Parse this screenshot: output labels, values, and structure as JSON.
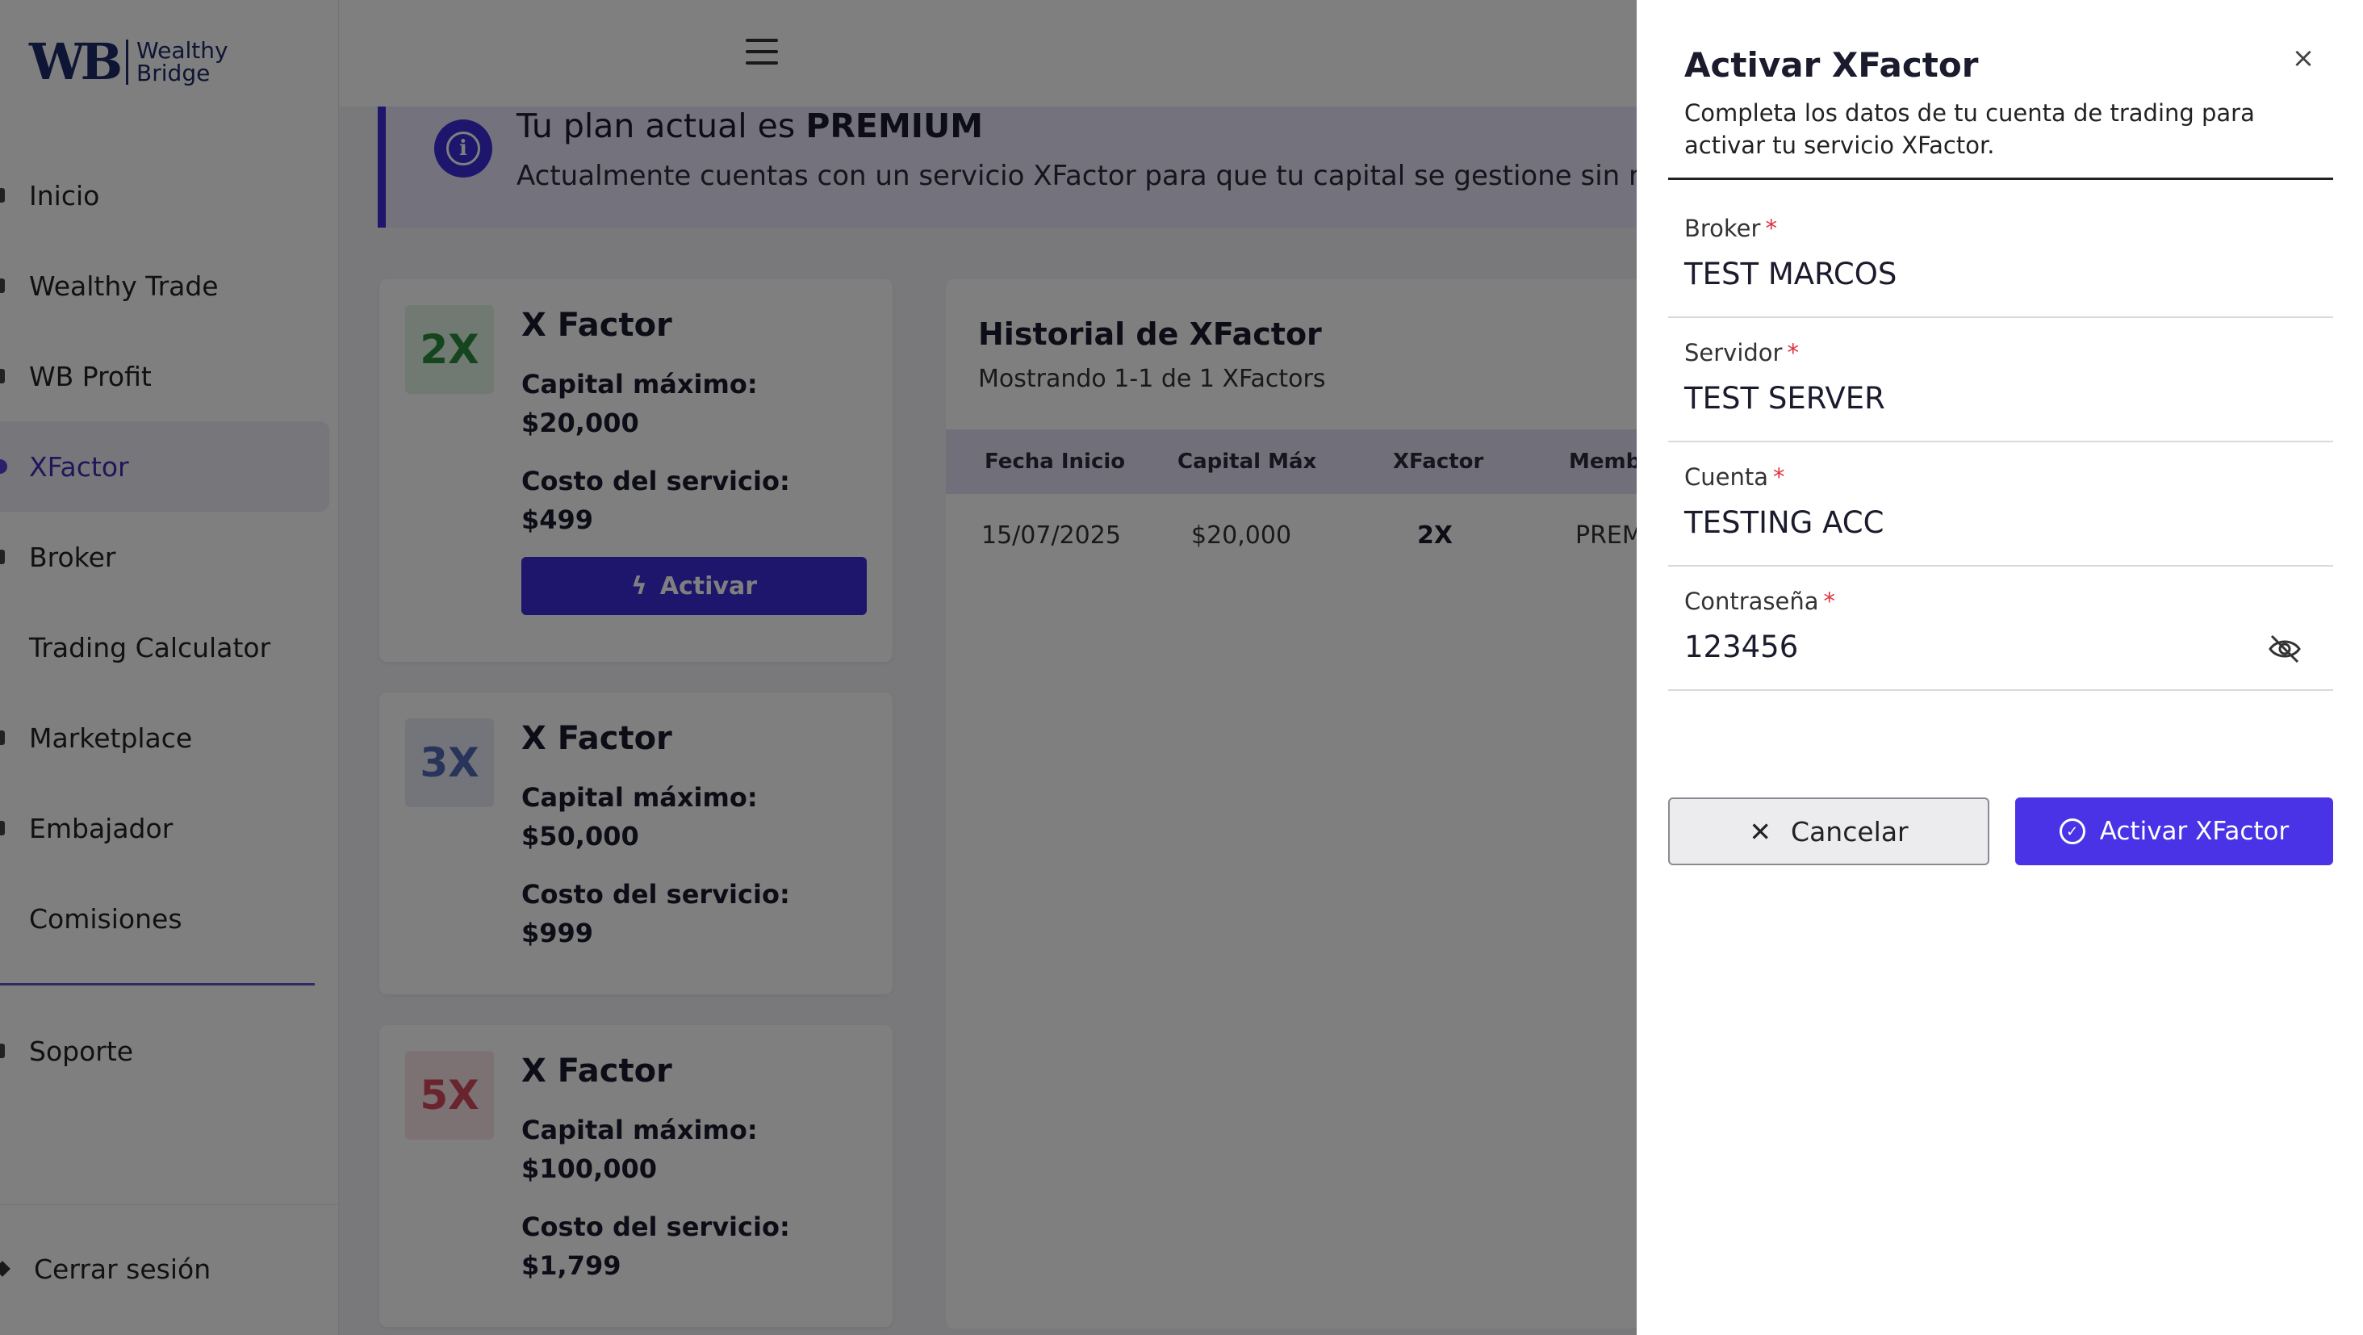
{
  "brand": {
    "mark": "WB",
    "name_line1": "Wealthy",
    "name_line2": "Bridge"
  },
  "sidebar": {
    "items": [
      {
        "label": "Inicio"
      },
      {
        "label": "Wealthy Trade"
      },
      {
        "label": "WB Profit"
      },
      {
        "label": "XFactor",
        "active": true
      },
      {
        "label": "Broker"
      },
      {
        "label": "Trading Calculator"
      },
      {
        "label": "Marketplace"
      },
      {
        "label": "Embajador"
      },
      {
        "label": "Comisiones"
      }
    ],
    "support": "Soporte",
    "logout": "Cerrar sesión"
  },
  "plan": {
    "title_prefix": "Tu plan actual es",
    "plan_name": "PREMIUM",
    "description": "Actualmente cuentas con un servicio XFactor para que tu capital se gestione sin reque"
  },
  "cards": [
    {
      "badge": "2X",
      "title": "X Factor",
      "capital_label": "Capital máximo:",
      "capital": "$20,000",
      "cost_label": "Costo del servicio:",
      "cost": "$499",
      "button": "Activar"
    },
    {
      "badge": "3X",
      "title": "X Factor",
      "capital_label": "Capital máximo:",
      "capital": "$50,000",
      "cost_label": "Costo del servicio:",
      "cost": "$999"
    },
    {
      "badge": "5X",
      "title": "X Factor",
      "capital_label": "Capital máximo:",
      "capital": "$100,000",
      "cost_label": "Costo del servicio:",
      "cost": "$1,799"
    }
  ],
  "history": {
    "title": "Historial de XFactor",
    "subtitle": "Mostrando 1-1 de 1 XFactors",
    "columns": [
      "Fecha Inicio",
      "Capital Máx",
      "XFactor",
      "Membr"
    ],
    "rows": [
      [
        "15/07/2025",
        "$20,000",
        "2X",
        "PREMI"
      ]
    ]
  },
  "drawer": {
    "title": "Activar XFactor",
    "description": "Completa los datos de tu cuenta de trading para activar tu servicio XFactor.",
    "close_glyph": "×",
    "required_mark": "*",
    "fields": [
      {
        "label": "Broker",
        "value": "TEST MARCOS"
      },
      {
        "label": "Servidor",
        "value": "TEST SERVER"
      },
      {
        "label": "Cuenta",
        "value": "TESTING ACC"
      },
      {
        "label": "Contraseña",
        "value": "123456"
      }
    ],
    "cancel_label": "Cancelar",
    "cancel_glyph": "✕",
    "submit_label": "Activar XFactor",
    "submit_glyph": "✓"
  },
  "colors": {
    "primary": "#3b2cd8",
    "required": "#e0323f",
    "badge_2x": "#2a8a3c",
    "badge_3x": "#5369b5",
    "badge_5x": "#d2495c"
  },
  "icons": [
    "info-icon",
    "lightning-icon",
    "close-icon",
    "eye-off-icon",
    "check-circle-icon",
    "menu-icon"
  ]
}
